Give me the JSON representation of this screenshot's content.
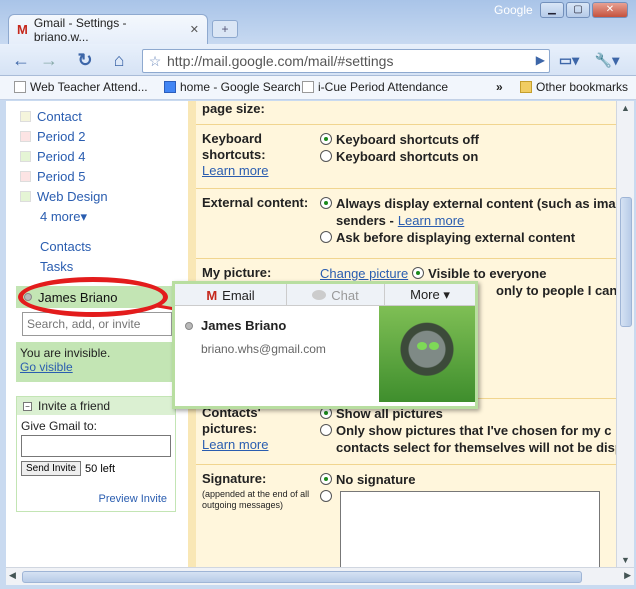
{
  "browser": {
    "tab_title": "Gmail - Settings - briano.w...",
    "google_label": "Google",
    "url": "http://mail.google.com/mail/#settings",
    "bookmarks": [
      "Web Teacher Attend...",
      "home - Google Search",
      "i-Cue Period Attendance"
    ],
    "bookmarks_overflow": "»",
    "other_bookmarks": "Other bookmarks"
  },
  "sidebar": {
    "labels": [
      {
        "name": "Contact",
        "color": "#f5f5dc"
      },
      {
        "name": "Period 2",
        "color": "#fce4e4"
      },
      {
        "name": "Period 4",
        "color": "#e5f5d5"
      },
      {
        "name": "Period 5",
        "color": "#fce4e4"
      },
      {
        "name": "Web Design",
        "color": "#e5f5d5"
      }
    ],
    "more": "4 more▾",
    "contacts": "Contacts",
    "tasks": "Tasks"
  },
  "chat": {
    "user_name": "James Briano",
    "search_placeholder": "Search, add, or invite",
    "status_text": "You are invisible.",
    "go_visible": "Go visible"
  },
  "invite": {
    "title": "Invite a friend",
    "give_label": "Give Gmail to:",
    "send_button": "Send Invite",
    "left_count": "50 left",
    "preview": "Preview Invite"
  },
  "settings": {
    "page_size_label": "page size:",
    "keyboard": {
      "label": "Keyboard shortcuts:",
      "learn_more": "Learn more",
      "opt_off": "Keyboard shortcuts off",
      "opt_on": "Keyboard shortcuts on"
    },
    "external": {
      "label": "External content:",
      "opt_always": "Always display external content (such as ima",
      "opt_always_cont": "senders -",
      "learn_more": "Learn more",
      "opt_ask": "Ask before displaying external content"
    },
    "picture": {
      "label": "My picture:",
      "change": "Change picture",
      "visible_everyone": "Visible to everyone",
      "visible_only": "only to people I can"
    },
    "contacts_pictures": {
      "label": "Contacts' pictures:",
      "learn_more": "Learn more",
      "opt_all": "Show all pictures",
      "opt_only": "Only show pictures that I've chosen for my c",
      "opt_only_cont": "contacts select for themselves will not be displa"
    },
    "signature": {
      "label": "Signature:",
      "sub": "(appended at the end of all outgoing messages)",
      "opt_none": "No signature"
    }
  },
  "card": {
    "tab_email": "Email",
    "tab_chat": "Chat",
    "tab_more": "More ▾",
    "name": "James Briano",
    "email": "briano.whs@gmail.com"
  }
}
